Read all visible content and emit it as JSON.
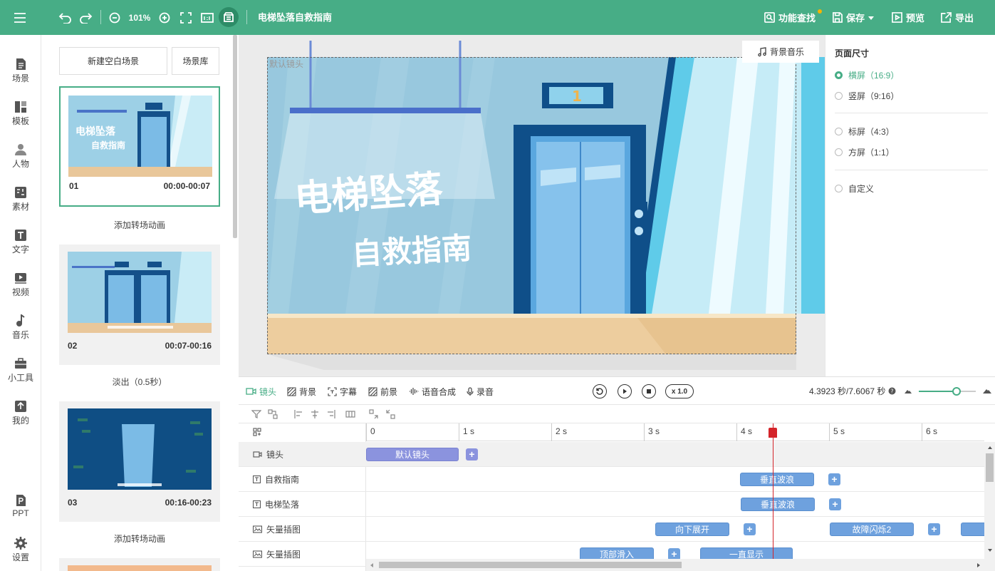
{
  "header": {
    "title": "电梯坠落自救指南",
    "zoom": "101%",
    "feature_search": "功能查找",
    "save": "保存",
    "preview": "预览",
    "export": "导出"
  },
  "nav": [
    {
      "label": "场景",
      "icon": "scene-icon"
    },
    {
      "label": "模板",
      "icon": "template-icon"
    },
    {
      "label": "人物",
      "icon": "person-icon"
    },
    {
      "label": "素材",
      "icon": "material-icon"
    },
    {
      "label": "文字",
      "icon": "text-icon"
    },
    {
      "label": "视频",
      "icon": "video-icon"
    },
    {
      "label": "音乐",
      "icon": "music-icon"
    },
    {
      "label": "小工具",
      "icon": "toolbox-icon"
    },
    {
      "label": "我的",
      "icon": "upload-icon"
    },
    {
      "label": "PPT",
      "icon": "ppt-icon"
    },
    {
      "label": "设置",
      "icon": "settings-icon"
    }
  ],
  "scenes": {
    "new_blank": "新建空白场景",
    "library": "场景库",
    "items": [
      {
        "num": "01",
        "time": "00:00-00:07",
        "transition": "添加转场动画"
      },
      {
        "num": "02",
        "time": "00:07-00:16",
        "transition": "淡出（0.5秒）"
      },
      {
        "num": "03",
        "time": "00:16-00:23",
        "transition": "添加转场动画"
      }
    ]
  },
  "canvas": {
    "stage_label": "默认镜头",
    "bgm": "背景音乐",
    "text1": "电梯坠落",
    "text2": "自救指南",
    "floor": "1"
  },
  "page_size": {
    "title": "页面尺寸",
    "options": [
      {
        "label": "横屏（16:9）",
        "selected": true
      },
      {
        "label": "竖屏（9:16）",
        "selected": false
      },
      {
        "label": "标屏（4:3）",
        "selected": false
      },
      {
        "label": "方屏（1:1）",
        "selected": false
      },
      {
        "label": "自定义",
        "selected": false
      }
    ]
  },
  "timeline": {
    "tabs": [
      "镜头",
      "背景",
      "字幕",
      "前景",
      "语音合成",
      "录音"
    ],
    "speed": "x 1.0",
    "time": "4.3923 秒/7.6067 秒",
    "ruler": [
      "0",
      "1 s",
      "2 s",
      "3 s",
      "4 s",
      "5 s",
      "6 s"
    ],
    "tracks": [
      {
        "label": "镜头",
        "clips": [
          "默认镜头"
        ]
      },
      {
        "label": "自救指南",
        "clips": [
          "垂直波浪"
        ]
      },
      {
        "label": "电梯坠落",
        "clips": [
          "垂直波浪"
        ]
      },
      {
        "label": "矢量插图",
        "clips": [
          "向下展开",
          "故障闪烁2"
        ]
      },
      {
        "label": "矢量插图",
        "clips": [
          "顶部滑入",
          "一直显示"
        ]
      }
    ],
    "playhead_seconds": 4.3923,
    "duration_seconds": 7.6067,
    "zoom_slider": 0.66
  }
}
